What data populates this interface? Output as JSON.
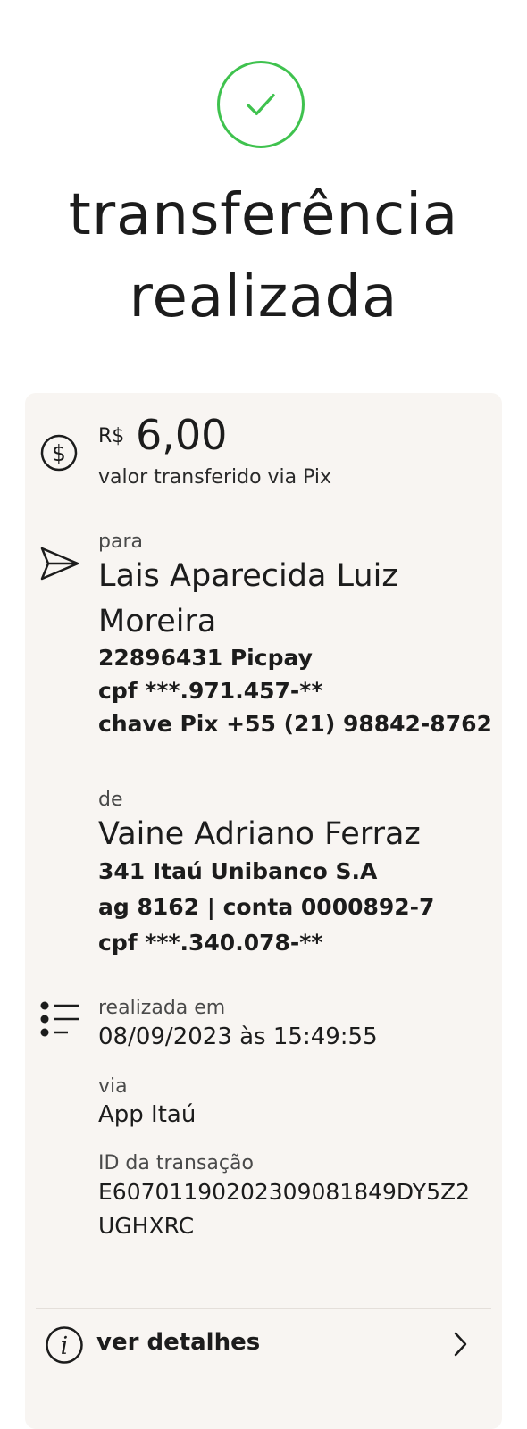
{
  "header": {
    "title_line1": "transferência",
    "title_line2": "realizada"
  },
  "amount": {
    "currency": "R$",
    "value": "6,00",
    "label": "valor transferido via Pix"
  },
  "recipient": {
    "label": "para",
    "name_line1": "Lais Aparecida Luiz",
    "name_line2": "Moreira",
    "bank": "22896431 Picpay",
    "cpf": "cpf ***.971.457-**",
    "pix_key": "chave Pix +55 (21) 98842-8762"
  },
  "sender": {
    "label": "de",
    "name": "Vaine Adriano Ferraz",
    "bank": "341 Itaú Unibanco S.A",
    "account": "ag 8162 | conta 0000892-7",
    "cpf": "cpf ***.340.078-**"
  },
  "details": {
    "date_label": "realizada em",
    "date_value": "08/09/2023 às 15:49:55",
    "via_label": "via",
    "via_value": "App Itaú",
    "id_label": "ID da transação",
    "id_line1": "E60701190202309081849DY5Z2",
    "id_line2": "UGHXRC"
  },
  "footer": {
    "details_label": "ver detalhes"
  },
  "colors": {
    "success": "#3fc24e",
    "card_bg": "#f8f5f2"
  }
}
